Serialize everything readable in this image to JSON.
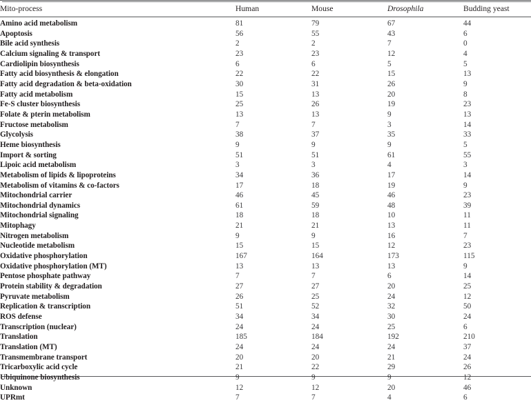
{
  "table": {
    "caption_columns": [
      "Mito-process",
      "Human",
      "Mouse",
      "Drosophila",
      "Budding yeast"
    ],
    "header": {
      "process": "Mito-process",
      "human": "Human",
      "mouse": "Mouse",
      "drosophila": "Drosophila",
      "yeast": "Budding yeast"
    },
    "rows": [
      {
        "process": "Amino acid metabolism",
        "human": "81",
        "mouse": "79",
        "drosophila": "67",
        "yeast": "44"
      },
      {
        "process": "Apoptosis",
        "human": "56",
        "mouse": "55",
        "drosophila": "43",
        "yeast": "6"
      },
      {
        "process": "Bile acid synthesis",
        "human": "2",
        "mouse": "2",
        "drosophila": "7",
        "yeast": "0"
      },
      {
        "process": "Calcium signaling & transport",
        "human": "23",
        "mouse": "23",
        "drosophila": "12",
        "yeast": "4"
      },
      {
        "process": "Cardiolipin biosynthesis",
        "human": "6",
        "mouse": "6",
        "drosophila": "5",
        "yeast": "5"
      },
      {
        "process": "Fatty acid biosynthesis & elongation",
        "human": "22",
        "mouse": "22",
        "drosophila": "15",
        "yeast": "13"
      },
      {
        "process": "Fatty acid degradation & beta-oxidation",
        "human": "30",
        "mouse": "31",
        "drosophila": "26",
        "yeast": "9"
      },
      {
        "process": "Fatty acid metabolism",
        "human": "15",
        "mouse": "13",
        "drosophila": "20",
        "yeast": "8"
      },
      {
        "process": "Fe-S cluster biosynthesis",
        "human": "25",
        "mouse": "26",
        "drosophila": "19",
        "yeast": "23"
      },
      {
        "process": "Folate & pterin metabolism",
        "human": "13",
        "mouse": "13",
        "drosophila": "9",
        "yeast": "13"
      },
      {
        "process": "Fructose metabolism",
        "human": "7",
        "mouse": "7",
        "drosophila": "3",
        "yeast": "14"
      },
      {
        "process": "Glycolysis",
        "human": "38",
        "mouse": "37",
        "drosophila": "35",
        "yeast": "33"
      },
      {
        "process": "Heme biosynthesis",
        "human": "9",
        "mouse": "9",
        "drosophila": "9",
        "yeast": "5"
      },
      {
        "process": "Import & sorting",
        "human": "51",
        "mouse": "51",
        "drosophila": "61",
        "yeast": "55"
      },
      {
        "process": "Lipoic acid metabolism",
        "human": "3",
        "mouse": "3",
        "drosophila": "4",
        "yeast": "3"
      },
      {
        "process": "Metabolism of lipids & lipoproteins",
        "human": "34",
        "mouse": "36",
        "drosophila": "17",
        "yeast": "14"
      },
      {
        "process": "Metabolism of vitamins & co-factors",
        "human": "17",
        "mouse": "18",
        "drosophila": "19",
        "yeast": "9"
      },
      {
        "process": "Mitochondrial carrier",
        "human": "46",
        "mouse": "45",
        "drosophila": "46",
        "yeast": "23"
      },
      {
        "process": "Mitochondrial dynamics",
        "human": "61",
        "mouse": "59",
        "drosophila": "48",
        "yeast": "39"
      },
      {
        "process": "Mitochondrial signaling",
        "human": "18",
        "mouse": "18",
        "drosophila": "10",
        "yeast": "11"
      },
      {
        "process": "Mitophagy",
        "human": "21",
        "mouse": "21",
        "drosophila": "13",
        "yeast": "11"
      },
      {
        "process": "Nitrogen metabolism",
        "human": "9",
        "mouse": "9",
        "drosophila": "16",
        "yeast": "7"
      },
      {
        "process": "Nucleotide metabolism",
        "human": "15",
        "mouse": "15",
        "drosophila": "12",
        "yeast": "23"
      },
      {
        "process": "Oxidative phosphorylation",
        "human": "167",
        "mouse": "164",
        "drosophila": "173",
        "yeast": "115"
      },
      {
        "process": "Oxidative phosphorylation (MT)",
        "human": "13",
        "mouse": "13",
        "drosophila": "13",
        "yeast": "9"
      },
      {
        "process": "Pentose phosphate pathway",
        "human": "7",
        "mouse": "7",
        "drosophila": "6",
        "yeast": "14"
      },
      {
        "process": "Protein stability & degradation",
        "human": "27",
        "mouse": "27",
        "drosophila": "20",
        "yeast": "25"
      },
      {
        "process": "Pyruvate metabolism",
        "human": "26",
        "mouse": "25",
        "drosophila": "24",
        "yeast": "12"
      },
      {
        "process": "Replication & transcription",
        "human": "51",
        "mouse": "52",
        "drosophila": "32",
        "yeast": "50"
      },
      {
        "process": "ROS defense",
        "human": "34",
        "mouse": "34",
        "drosophila": "30",
        "yeast": "24"
      },
      {
        "process": "Transcription (nuclear)",
        "human": "24",
        "mouse": "24",
        "drosophila": "25",
        "yeast": "6"
      },
      {
        "process": "Translation",
        "human": "185",
        "mouse": "184",
        "drosophila": "192",
        "yeast": "210"
      },
      {
        "process": "Translation (MT)",
        "human": "24",
        "mouse": "24",
        "drosophila": "24",
        "yeast": "37"
      },
      {
        "process": "Transmembrane transport",
        "human": "20",
        "mouse": "20",
        "drosophila": "21",
        "yeast": "24"
      },
      {
        "process": "Tricarboxylic acid cycle",
        "human": "21",
        "mouse": "22",
        "drosophila": "29",
        "yeast": "26"
      },
      {
        "process": "Ubiquinone biosynthesis",
        "human": "9",
        "mouse": "9",
        "drosophila": "9",
        "yeast": "12"
      },
      {
        "process": "Unknown",
        "human": "12",
        "mouse": "12",
        "drosophila": "20",
        "yeast": "46"
      },
      {
        "process": "UPRmt",
        "human": "7",
        "mouse": "7",
        "drosophila": "4",
        "yeast": "6"
      }
    ]
  },
  "colors": {
    "rule": "#58595b",
    "text": "#231f20",
    "number_text": "#3b3b3d",
    "background": "#ffffff"
  }
}
